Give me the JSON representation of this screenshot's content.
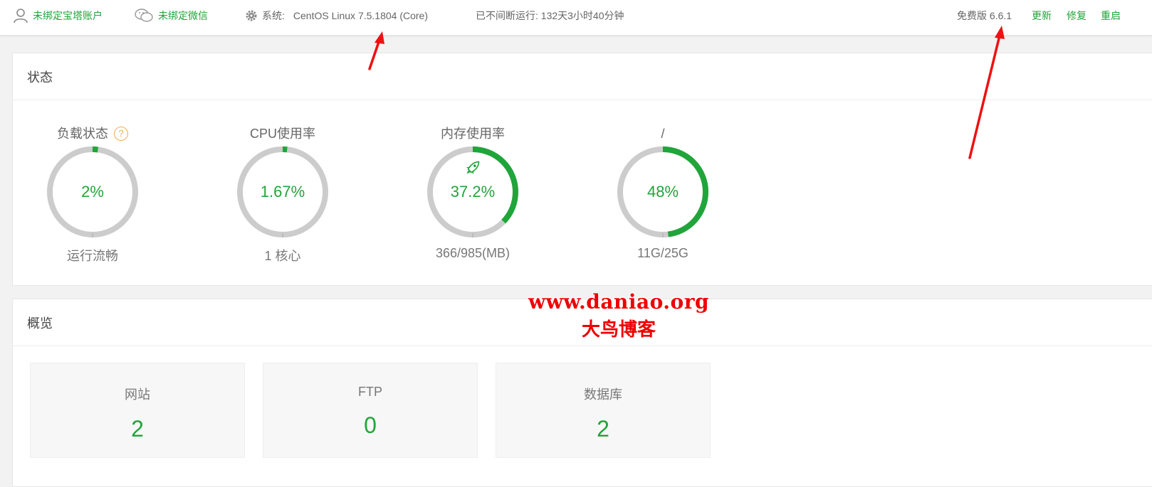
{
  "topbar": {
    "bind_account": "未绑定宝塔账户",
    "bind_wechat": "未绑定微信",
    "system_label": "系统:",
    "system_value": "CentOS Linux 7.5.1804 (Core)",
    "uptime": "已不间断运行: 132天3小时40分钟",
    "version": "免费版 6.6.1",
    "update": "更新",
    "repair": "修复",
    "restart": "重启"
  },
  "status": {
    "title": "状态",
    "gauges": [
      {
        "title": "负载状态",
        "help": "?",
        "value": "2%",
        "percent": 2,
        "sub": "运行流畅"
      },
      {
        "title": "CPU使用率",
        "value": "1.67%",
        "percent": 1.67,
        "sub": "1 核心"
      },
      {
        "title": "内存使用率",
        "value": "37.2%",
        "percent": 37.2,
        "sub": "366/985(MB)",
        "icon": "rocket-icon"
      },
      {
        "title": "/",
        "value": "48%",
        "percent": 48,
        "sub": "11G/25G"
      }
    ]
  },
  "overview": {
    "title": "概览",
    "cards": [
      {
        "label": "网站",
        "count": "2"
      },
      {
        "label": "FTP",
        "count": "0"
      },
      {
        "label": "数据库",
        "count": "2"
      }
    ]
  },
  "watermark": {
    "url": "www.daniao.org",
    "name": "大鸟博客"
  },
  "colors": {
    "accent": "#20a53a",
    "track": "#cccccc",
    "arrow": "#ee1111"
  }
}
